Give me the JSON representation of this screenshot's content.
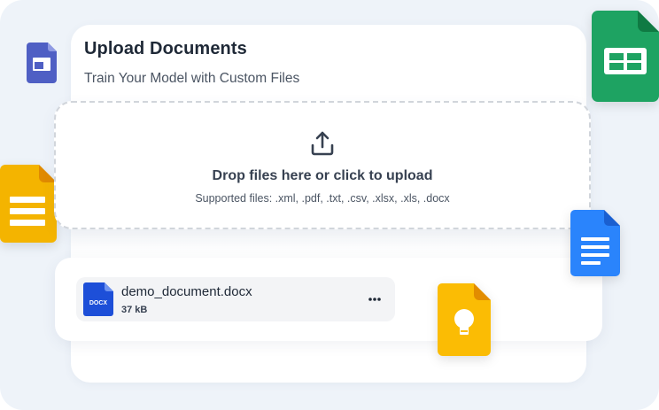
{
  "header": {
    "title": "Upload Documents",
    "subtitle": "Train Your Model with Custom Files"
  },
  "dropzone": {
    "title": "Drop files here or click to upload",
    "hint": "Supported files: .xml, .pdf, .txt, .csv, .xlsx, .xls, .docx",
    "icon": "upload-icon"
  },
  "files": [
    {
      "name": "demo_document.docx",
      "size": "37 kB",
      "icon": "docx-file-icon",
      "badge": "DOCX"
    }
  ],
  "decorations": [
    "google-sites-icon",
    "google-sheets-icon",
    "google-slides-icon",
    "google-docs-icon",
    "google-keep-icon"
  ],
  "colors": {
    "sheets": "#1ea362",
    "slides": "#f4b400",
    "docs": "#2a84fc",
    "keep": "#fbbc04",
    "sites": "#4f5fc4",
    "docx": "#1d4fd8",
    "background": "#eef3f9"
  }
}
